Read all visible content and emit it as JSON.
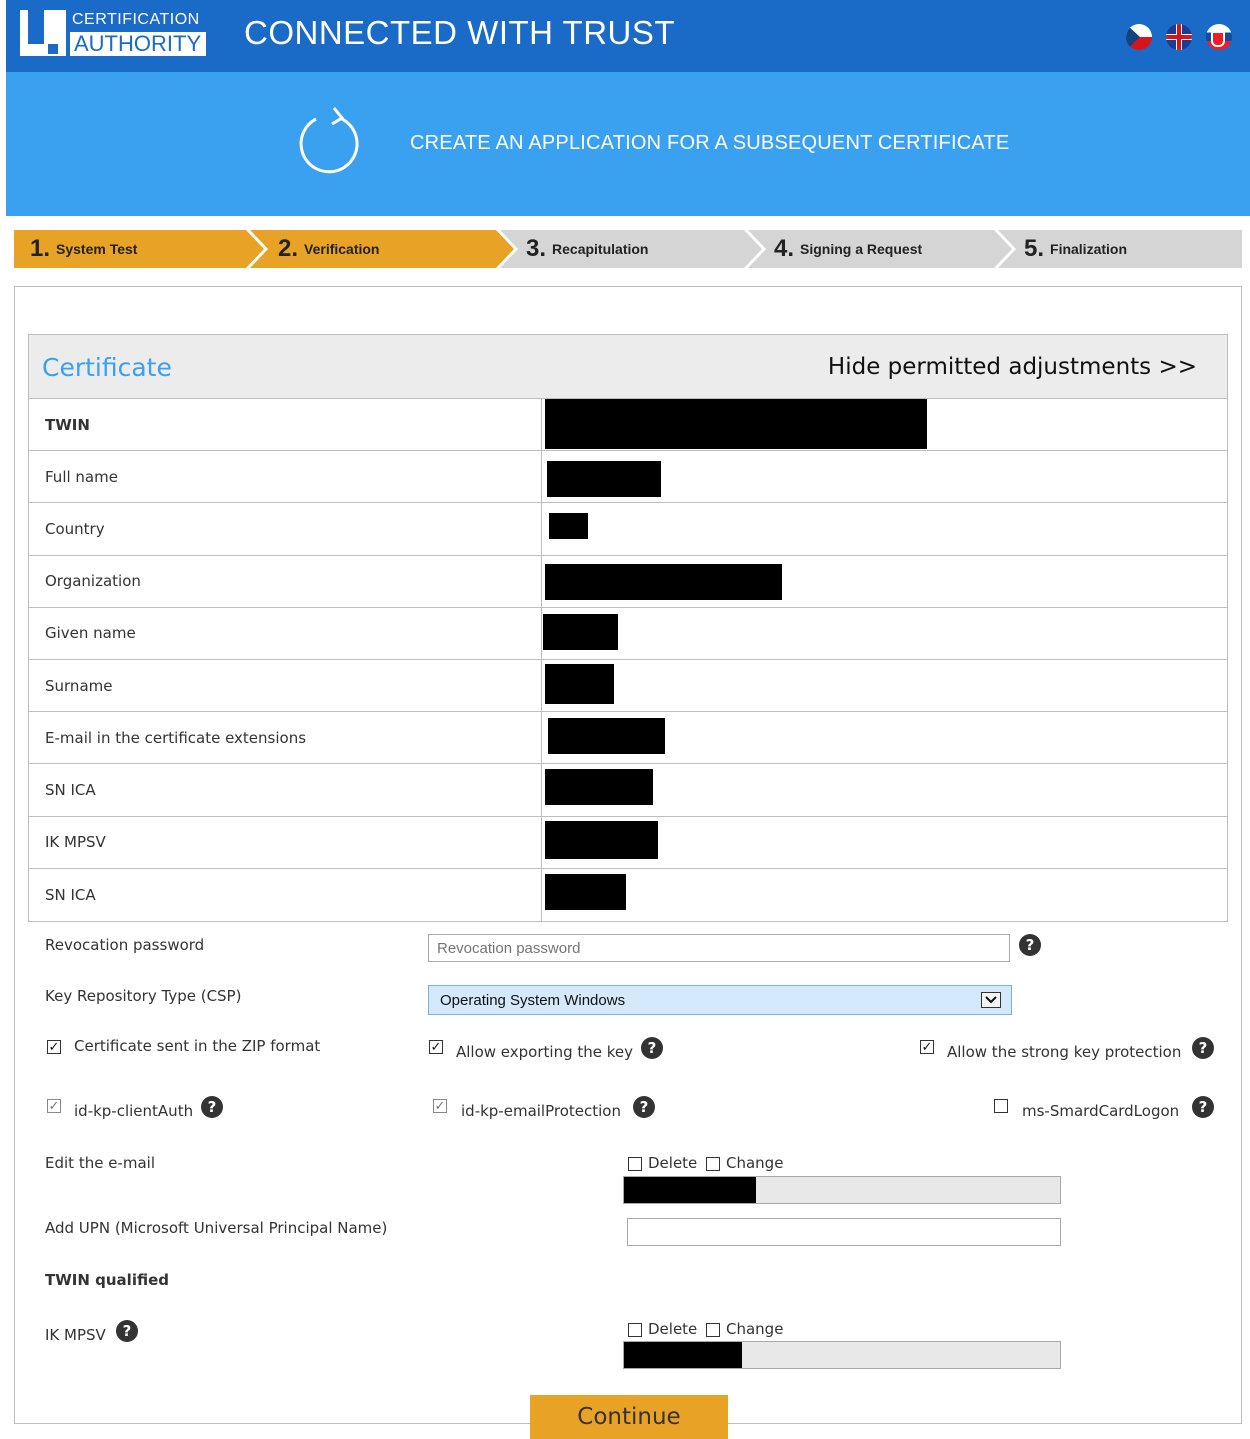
{
  "header": {
    "logo_line1": "CERTIFICATION",
    "logo_line2": "AUTHORITY",
    "tagline": "CONNECTED WITH TRUST",
    "flags": [
      "czech-flag-icon",
      "uk-flag-icon",
      "slovak-flag-icon"
    ]
  },
  "banner": {
    "icon": "refresh-icon",
    "title": "CREATE AN APPLICATION FOR A SUBSEQUENT CERTIFICATE"
  },
  "steps": [
    {
      "num": "1.",
      "label": "System Test",
      "state": "active"
    },
    {
      "num": "2.",
      "label": "Verification",
      "state": "active"
    },
    {
      "num": "3.",
      "label": "Recapitulation",
      "state": "idle"
    },
    {
      "num": "4.",
      "label": "Signing a Request",
      "state": "idle"
    },
    {
      "num": "5.",
      "label": "Finalization",
      "state": "idle"
    }
  ],
  "certificate": {
    "title": "Certificate",
    "toggle": "Hide permitted adjustments >>",
    "rows": [
      {
        "label": "TWIN"
      },
      {
        "label": "Full name"
      },
      {
        "label": "Country"
      },
      {
        "label": "Organization"
      },
      {
        "label": "Given name"
      },
      {
        "label": "Surname"
      },
      {
        "label": "E-mail in the certificate extensions"
      },
      {
        "label": "SN ICA"
      },
      {
        "label": "IK MPSV"
      },
      {
        "label": "SN ICA"
      }
    ]
  },
  "form": {
    "revocation_label": "Revocation password",
    "revocation_placeholder": "Revocation password",
    "csp_label": "Key Repository Type (CSP)",
    "csp_value": "Operating System Windows",
    "zip_label": "Certificate sent in the ZIP format",
    "export_label": "Allow exporting the key",
    "strong_label": "Allow the strong key protection",
    "client_auth_label": "id-kp-clientAuth",
    "email_protection_label": "id-kp-emailProtection",
    "smartcard_label": "ms-SmardCardLogon",
    "edit_email_label": "Edit the e-mail",
    "delete_label": "Delete",
    "change_label": "Change",
    "upn_label": "Add UPN (Microsoft Universal Principal Name)",
    "twin_qualified_label": "TWIN qualified",
    "ik_mpsv_label": "IK MPSV",
    "help_glyph": "?",
    "check_glyph": "✓"
  },
  "continue_label": "Continue",
  "colors": {
    "header_blue": "#1a6ac8",
    "banner_blue": "#3aa0f0",
    "accent_orange": "#e8a226",
    "step_grey": "#d5d5d5"
  }
}
